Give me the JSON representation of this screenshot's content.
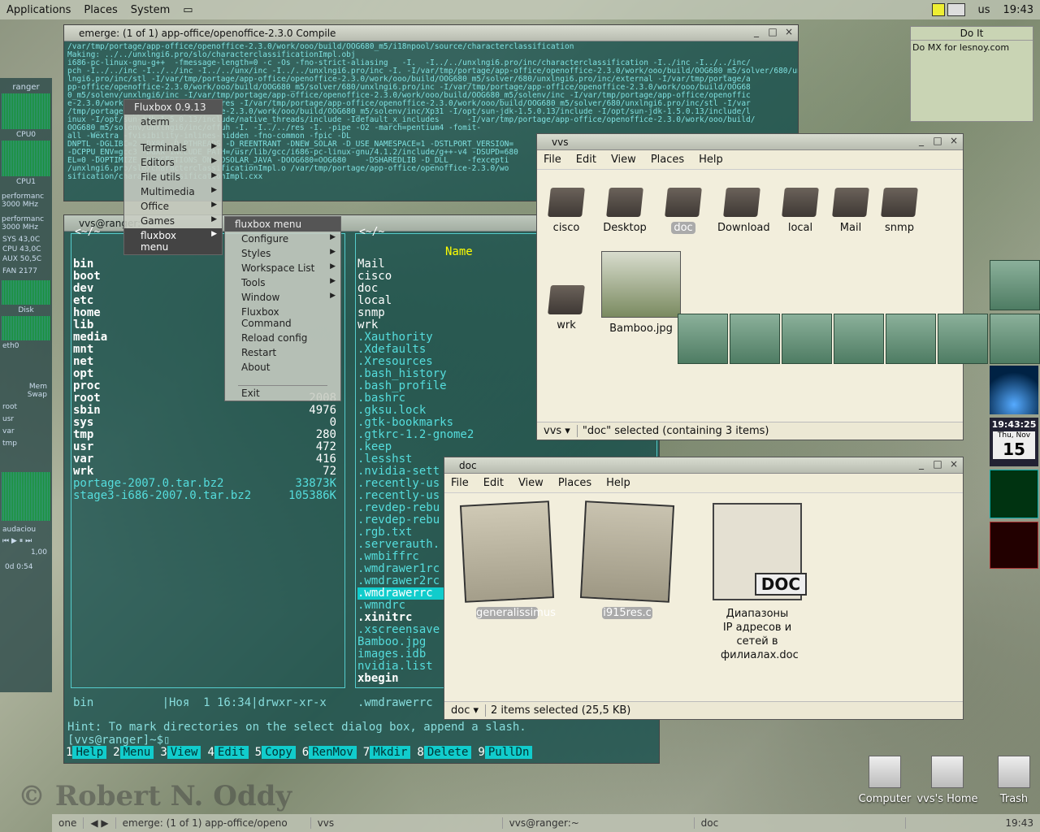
{
  "toppanel": {
    "applications": "Applications",
    "places": "Places",
    "system": "System",
    "kbd": "us",
    "clock": "19:43"
  },
  "emerge": {
    "title": "emerge: (1 of 1) app-office/openoffice-2.3.0 Compile",
    "lines": [
      "/var/tmp/portage/app-office/openoffice-2.3.0/work/ooo/build/OOG680_m5/i18npool/source/characterclassification",
      "",
      "Making: ../../unxlngi6.pro/slo/characterclassificationImpl.obj",
      "i686-pc-linux-gnu-g++  -fmessage-length=0 -c -Os -fno-strict-aliasing   -I.  -I../../unxlngi6.pro/inc/characterclassification -I../inc -I../../inc/",
      "pch -I../../inc -I../../inc -I../../unx/inc -I../../unxlngi6.pro/inc -I. -I/var/tmp/portage/app-office/openoffice-2.3.0/work/ooo/build/OOG680_m5/solver/680/unx",
      "lngi6.pro/inc/stl -I/var/tmp/portage/app-office/openoffice-2.3.0/work/ooo/build/OOG680_m5/solver/680/unxlngi6.pro/inc/external -I/var/tmp/portage/a",
      "pp-office/openoffice-2.3.0/work/ooo/build/OOG680_m5/solver/680/unxlngi6.pro/inc -I/var/tmp/portage/app-office/openoffice-2.3.0/work/ooo/build/OOG68",
      "0_m5/solenv/unxlngi6/inc -I/var/tmp/portage/app-office/openoffice-2.3.0/work/ooo/build/OOG680_m5/solenv/inc -I/var/tmp/portage/app-office/openoffic",
      "e-2.3.0/work/ooo/build/OOG680_m5/res -I/var/tmp/portage/app-office/openoffice-2.3.0/work/ooo/build/OOG680_m5/solver/680/unxlngi6.pro/inc/stl -I/var",
      "/tmp/portage/app-office/openoffice-2.3.0/work/ooo/build/OOG680_m5/solenv/inc/Xp31 -I/opt/sun-jdk-1.5.0.13/include -I/opt/sun-jdk-1.5.0.13/include/l",
      "inux -I/opt/sun-jdk-1.5.0.13/include/native_threads/include -Idefault_x_includes      -I/var/tmp/portage/app-office/openoffice-2.3.0/work/ooo/build/",
      "OOG680_m5/solenv/unxlngi6/inc/offuh -I. -I../../res -I. -pipe -O2 -march=pentium4 -fomit-",
      "all -Wextra -fvisibility-inlines-hidden -fno-common -fpic -DL",
      "DNPTL -DGLIBC=2 -DX86 -D_PTHREADS -D_REENTRANT -DNEW_SOLAR -D_USE_NAMESPACE=1 -DSTLPORT_VERSION=",
      "-DCPPU_ENV=gcc3 -DGXX_INCLUDE_PATH=/usr/lib/gcc/i686-pc-linux-gnu/4.1.2/include/g++-v4 -DSUPD=680",
      "EL=0 -DOPTIMIZE -DEXCEPTIONS_ON -DSOLAR_JAVA -DOOG680=OOG680    -DSHAREDLIB -D_DLL_   -fexcepti",
      "/unxlngi6.pro/slo/characterclassificationImpl.o /var/tmp/portage/app-office/openoffice-2.3.0/wo",
      "sification/characterclassificationImpl.cxx"
    ]
  },
  "fluxmenu": {
    "title": "Fluxbox 0.9.13",
    "items": [
      "aterm",
      "",
      "Terminals",
      "Editors",
      "File utils",
      "Multimedia",
      "Office",
      "Games",
      "fluxbox menu"
    ]
  },
  "submenu": {
    "title": "fluxbox menu",
    "items": [
      "Configure",
      "Styles",
      "Workspace List",
      "Tools",
      "Window",
      "Fluxbox Command",
      "Reload config",
      "Restart",
      "About",
      "",
      "Exit"
    ]
  },
  "mc": {
    "title": "vvs@ranger:~",
    "left_path": "<~/~",
    "right_path": "<~/~",
    "name_hdr": "Name",
    "left_files": [
      "bin",
      "boot",
      "dev",
      "etc",
      "home",
      "lib",
      "media",
      "mnt",
      "net",
      "opt",
      "proc",
      "root",
      "sbin",
      "sys",
      "tmp",
      "usr",
      "var",
      "wrk"
    ],
    "left_sizes": [
      "",
      "",
      "",
      "",
      "",
      "",
      "",
      "",
      "",
      "",
      "",
      "2008",
      "4976",
      "0",
      "280",
      "472",
      "416",
      "72"
    ],
    "left_extra": [
      "portage-2007.0.tar.bz2",
      "stage3-i686-2007.0.tar.bz2"
    ],
    "left_extra_sizes": [
      "33873K",
      "105386K"
    ],
    "right_files": [
      "Mail",
      "cisco",
      "doc",
      "local",
      "snmp",
      "wrk",
      ".Xauthority",
      ".Xdefaults",
      ".Xresources",
      ".bash_history",
      ".bash_profile",
      ".bashrc",
      ".gksu.lock",
      ".gtk-bookmarks",
      ".gtkrc-1.2-gnome2",
      ".keep",
      ".lesshst",
      ".nvidia-sett",
      ".recently-us",
      ".recently-us",
      ".revdep-rebu",
      ".revdep-rebu",
      ".rgb.txt",
      ".serverauth.",
      ".wmbiffrc",
      ".wmdrawer1rc",
      ".wmdrawer2rc",
      ".wmdrawerrc",
      ".wmndrc",
      ".xinitrc",
      ".xscreensave",
      "Bamboo.jpg",
      "images.idb",
      "nvidia.list",
      "xbegin"
    ],
    "left_status": "bin          |Ноя  1 16:34|drwxr-xr-x",
    "right_status": ".wmdrawerrc",
    "hint": "Hint: To mark directories on the select dialog box, append a slash.",
    "prompt": "[vvs@ranger]~$",
    "keys": [
      [
        "1",
        "Help"
      ],
      [
        "2",
        "Menu"
      ],
      [
        "3",
        "View"
      ],
      [
        "4",
        "Edit"
      ],
      [
        "5",
        "Copy"
      ],
      [
        "6",
        "RenMov"
      ],
      [
        "7",
        "Mkdir"
      ],
      [
        "8",
        "Delete"
      ],
      [
        "9",
        "PullDn"
      ]
    ]
  },
  "vvs": {
    "title": "vvs",
    "menu": [
      "File",
      "Edit",
      "View",
      "Places",
      "Help"
    ],
    "icons": [
      "cisco",
      "Desktop",
      "doc",
      "Download",
      "local",
      "Mail",
      "snmp",
      "wrk",
      "Bamboo.jpg"
    ],
    "location": "vvs",
    "status": "\"doc\" selected (containing 3 items)"
  },
  "docwin": {
    "title": "doc",
    "menu": [
      "File",
      "Edit",
      "View",
      "Places",
      "Help"
    ],
    "icons": [
      "generalissimus",
      "i915res.c",
      "Диапазоны IP адресов и сетей в филиалах.doc"
    ],
    "doc_badge": "DOC",
    "location": "doc",
    "status": "2 items selected (25,5 KB)"
  },
  "doit": {
    "title": "Do It",
    "text": "Do MX for lesnoy.com"
  },
  "sidebar": {
    "host": "ranger",
    "cpu0": "85%",
    "cpu0_lbl": "CPU0",
    "cpu1": "38%",
    "cpu1_lbl": "CPU1",
    "perf1": "performanc 3000 MHz",
    "perf2": "performanc 3000 MHz",
    "sys": "SYS 43,0C",
    "cpu": "CPU 43,0C",
    "aux": "AUX 50,5C",
    "fan": "FAN 2177",
    "disk": "Disk",
    "eth0": "eth0",
    "mem": "Mem",
    "swap": "Swap",
    "root": "root",
    "usr": "usr",
    "var": "var",
    "tmp": "tmp",
    "audacious": "audaciou",
    "vol": "1,00",
    "time": "0d  0:54"
  },
  "rightdock": {
    "clock": "19:43:25",
    "date": "Thu, Nov",
    "day": "15"
  },
  "desktop": {
    "computer": "Computer",
    "home": "vvs's Home",
    "trash": "Trash",
    "watermark": "© Robert N. Oddy"
  },
  "bottombar": {
    "workspace": "one",
    "task1": "emerge: (1 of 1) app-office/openo",
    "task2": "vvs",
    "task3": "vvs@ranger:~",
    "task4": "doc",
    "clock": "19:43"
  }
}
